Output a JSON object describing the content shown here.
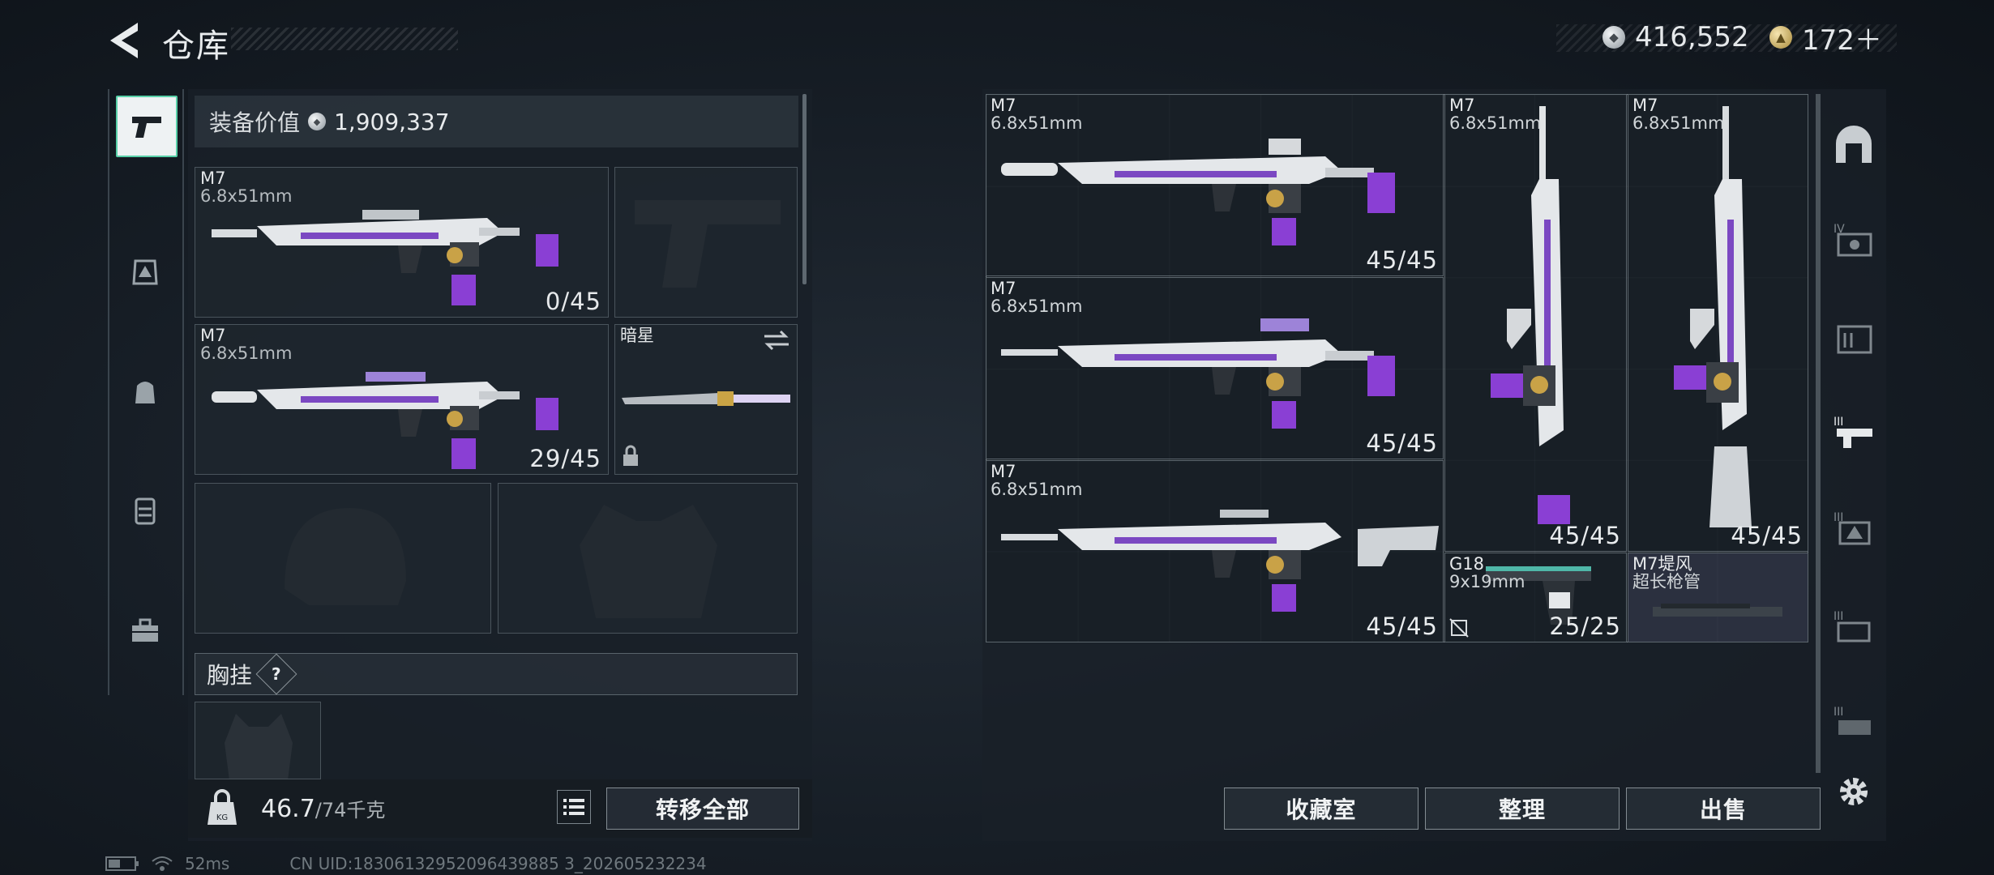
{
  "header": {
    "title": "仓库",
    "silver_amount": "416,552",
    "gold_amount": "172＋"
  },
  "left": {
    "equip_value_label": "装备价值",
    "equip_value": "1,909,337",
    "slots": [
      {
        "name": "M7",
        "caliber": "6.8x51mm",
        "ammo": "0/45"
      },
      {
        "name": "M7",
        "caliber": "6.8x51mm",
        "ammo": "29/45"
      },
      {
        "name": "暗星"
      }
    ],
    "chest_label": "胸挂",
    "chest_help": "?",
    "weight_current": "46.7",
    "weight_max": "/74千克",
    "transfer_all": "转移全部"
  },
  "right": {
    "items": [
      {
        "name": "M7",
        "caliber": "6.8x51mm",
        "ammo": "45/45"
      },
      {
        "name": "M7",
        "caliber": "6.8x51mm",
        "ammo": "45/45"
      },
      {
        "name": "M7",
        "caliber": "6.8x51mm",
        "ammo": "45/45"
      },
      {
        "name": "M7",
        "caliber": "6.8x51mm",
        "ammo": "45/45"
      },
      {
        "name": "M7",
        "caliber": "6.8x51mm",
        "ammo": "45/45"
      },
      {
        "name": "G18",
        "caliber": "9x19mm",
        "ammo": "25/25"
      },
      {
        "name": "M7堤风",
        "caliber": "超长枪管"
      }
    ],
    "buttons": {
      "collection": "收藏室",
      "organize": "整理",
      "sell": "出售"
    }
  },
  "status": {
    "ping": "52ms",
    "uid": "CN UID:18306132952096439885 3_202605232234"
  }
}
